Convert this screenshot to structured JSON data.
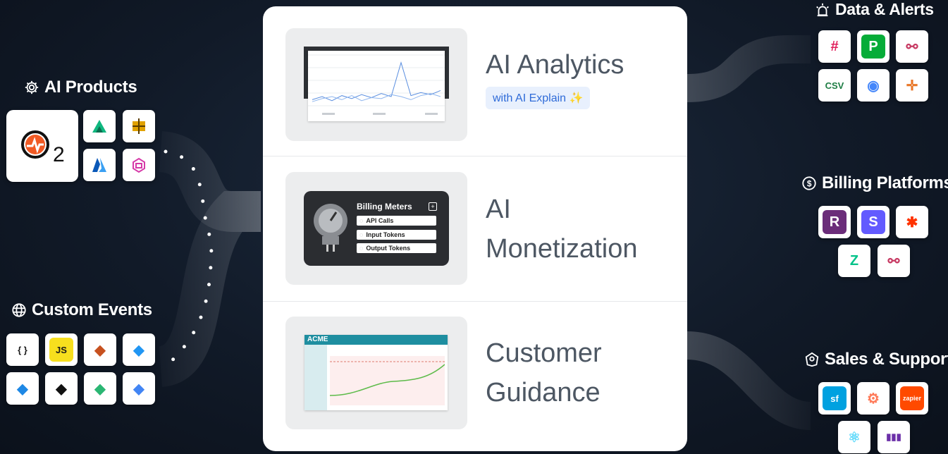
{
  "ai_products": {
    "title": "AI Products",
    "title_icon": "gear-icon",
    "logo_text": "2",
    "logos": [
      "anthropic-logo-icon",
      "perplexity-logo-icon",
      "azure-logo-icon",
      "vertex-ai-logo-icon"
    ]
  },
  "custom_events": {
    "title": "Custom Events",
    "title_icon": "globe-icon",
    "tiles": [
      {
        "icon": "json-icon",
        "text": "{ }",
        "color": "#1a1a1a",
        "bg": "#ffffff"
      },
      {
        "icon": "javascript-icon",
        "text": "JS",
        "color": "#1a1a1a",
        "bg": "#f7df1e"
      },
      {
        "icon": "aws-icon",
        "text": "",
        "color": "#c7511f",
        "bg": "#ffffff"
      },
      {
        "icon": "swift-bird-icon",
        "text": "",
        "color": "#2196f3",
        "bg": "#ffffff"
      },
      {
        "icon": "bird-icon",
        "text": "",
        "color": "#1e88e5",
        "bg": "#ffffff"
      },
      {
        "icon": "l-logo-icon",
        "text": "",
        "color": "#111",
        "bg": "#ffffff"
      },
      {
        "icon": "segment-icon",
        "text": "",
        "color": "#2bb673",
        "bg": "#ffffff"
      },
      {
        "icon": "diamond-tag-icon",
        "text": "",
        "color": "#4285f4",
        "bg": "#ffffff"
      }
    ]
  },
  "center_card": {
    "features": [
      {
        "title_lines": [
          "AI Analytics"
        ],
        "badge": "with AI Explain ✨"
      },
      {
        "title_lines": [
          "AI",
          "Monetization"
        ],
        "meter_title": "Billing Meters",
        "meters": [
          "API Calls",
          "Input Tokens",
          "Output Tokens"
        ]
      },
      {
        "title_lines": [
          "Customer",
          "Guidance"
        ],
        "brand": "ACME"
      }
    ]
  },
  "chart_data": {
    "type": "line",
    "title": "",
    "series": [
      {
        "values": [
          12,
          18,
          10,
          20,
          14,
          22,
          16,
          24,
          18,
          85,
          20,
          26,
          22,
          30
        ]
      },
      {
        "values": [
          8,
          14,
          18,
          12,
          20,
          10,
          16,
          14,
          22,
          18,
          12,
          20,
          24,
          18
        ]
      }
    ],
    "ylim": [
      0,
      100
    ],
    "grid": true
  },
  "data_alerts": {
    "title": "Data & Alerts",
    "title_icon": "siren-icon",
    "tiles": [
      {
        "icon": "slack-icon",
        "text": "#",
        "color": "#e01e5a",
        "bg": "#ffffff"
      },
      {
        "icon": "pagerduty-icon",
        "text": "P",
        "color": "#ffffff",
        "bg": "#06ac38"
      },
      {
        "icon": "webhook-icon",
        "text": "⚯",
        "color": "#c73a63",
        "bg": "#ffffff"
      },
      {
        "icon": "csv-icon",
        "text": "CSV",
        "color": "#1e7d44",
        "bg": "#ffffff"
      },
      {
        "icon": "bigquery-icon",
        "text": "◉",
        "color": "#4386fa",
        "bg": "#ffffff"
      },
      {
        "icon": "tableau-icon",
        "text": "✛",
        "color": "#e97627",
        "bg": "#ffffff"
      }
    ]
  },
  "billing_platforms": {
    "title": "Billing Platforms",
    "title_icon": "dollar-coin-icon",
    "tiles": [
      {
        "icon": "recurly-icon",
        "text": "R",
        "color": "#ffffff",
        "bg": "#6b2d7a"
      },
      {
        "icon": "stripe-icon",
        "text": "S",
        "color": "#ffffff",
        "bg": "#635bff"
      },
      {
        "icon": "chargebee-icon",
        "text": "✱",
        "color": "#ff3300",
        "bg": "#ffffff"
      },
      {
        "icon": "zuora-icon",
        "text": "Z",
        "color": "#00c389",
        "bg": "#ffffff"
      },
      {
        "icon": "webhook-icon",
        "text": "⚯",
        "color": "#c73a63",
        "bg": "#ffffff"
      }
    ]
  },
  "sales_support": {
    "title": "Sales & Support",
    "title_icon": "headset-icon",
    "tiles": [
      {
        "icon": "salesforce-icon",
        "text": "sf",
        "color": "#ffffff",
        "bg": "#00a1e0"
      },
      {
        "icon": "hubspot-icon",
        "text": "⚙",
        "color": "#ff7a59",
        "bg": "#ffffff"
      },
      {
        "icon": "zapier-icon",
        "text": "zapier",
        "color": "#ffffff",
        "bg": "#ff4a00"
      },
      {
        "icon": "react-icon",
        "text": "⚛",
        "color": "#61dafb",
        "bg": "#ffffff"
      },
      {
        "icon": "intercom-icon",
        "text": "▮▮▮",
        "color": "#6b2fa8",
        "bg": "#ffffff"
      }
    ]
  }
}
